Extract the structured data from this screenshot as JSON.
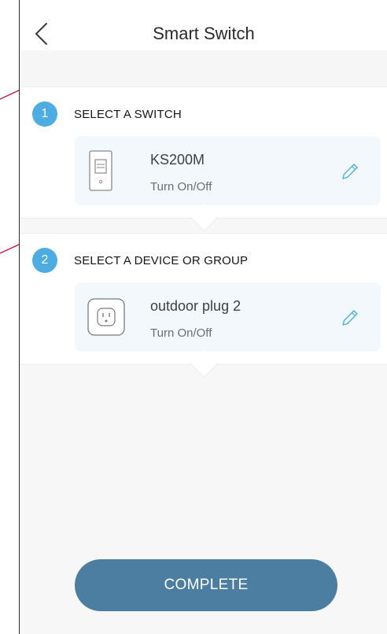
{
  "header": {
    "title": "Smart Switch",
    "back_icon": "chevron-left-icon"
  },
  "steps": [
    {
      "number": "1",
      "label": "SELECT A SWITCH",
      "device": {
        "name": "KS200M",
        "action": "Turn On/Off",
        "icon": "wall-switch-icon"
      }
    },
    {
      "number": "2",
      "label": "SELECT A DEVICE OR GROUP",
      "device": {
        "name": "outdoor plug 2",
        "action": "Turn On/Off",
        "icon": "smart-plug-icon"
      }
    }
  ],
  "edit_icon": "pencil-icon",
  "complete_button": {
    "label": "COMPLETE"
  },
  "colors": {
    "step_badge": "#4dade3",
    "card_background": "#f2f8fb",
    "edit_icon": "#4dade3",
    "complete_button": "#4b7ea1",
    "annotation_line": "#c8153a"
  }
}
